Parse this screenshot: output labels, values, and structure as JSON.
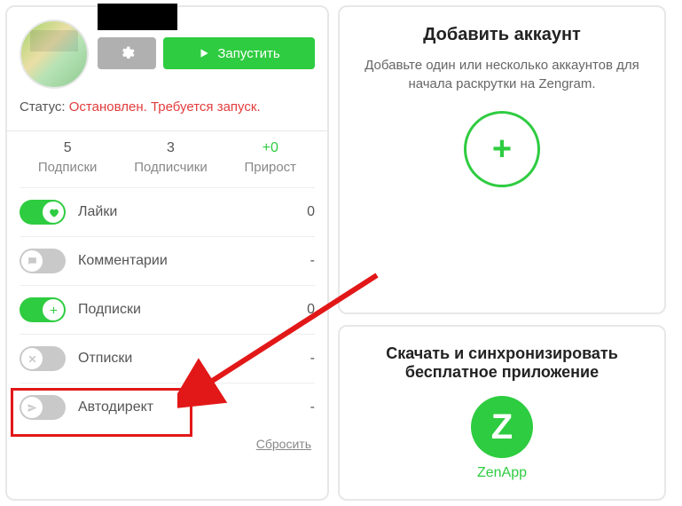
{
  "colors": {
    "accent": "#2ecc40",
    "danger": "#e23c3c",
    "highlight": "#e21818",
    "muted": "#b0b0b0"
  },
  "account": {
    "run_button": "Запустить",
    "status_label": "Статус:",
    "status_value": "Остановлен. Требуется запуск."
  },
  "stats": [
    {
      "value": "5",
      "label": "Подписки",
      "green": false
    },
    {
      "value": "3",
      "label": "Подписчики",
      "green": false
    },
    {
      "value": "+0",
      "label": "Прирост",
      "green": true
    }
  ],
  "options": [
    {
      "id": "likes",
      "label": "Лайки",
      "on": true,
      "value": "0",
      "icon": "heart"
    },
    {
      "id": "comments",
      "label": "Комментарии",
      "on": false,
      "value": "-",
      "icon": "comment"
    },
    {
      "id": "subs",
      "label": "Подписки",
      "on": true,
      "value": "0",
      "icon": "plus"
    },
    {
      "id": "unsubs",
      "label": "Отписки",
      "on": false,
      "value": "-",
      "icon": "x"
    },
    {
      "id": "autodirect",
      "label": "Автодирект",
      "on": false,
      "value": "-",
      "icon": "send"
    }
  ],
  "reset_label": "Сбросить",
  "add_panel": {
    "title": "Добавить аккаунт",
    "subtitle": "Добавьте один или несколько аккаунтов для начала раскрутки на Zengram."
  },
  "app_panel": {
    "title": "Скачать и синхронизировать бесплатное приложение",
    "badge": "Z",
    "name": "ZenApp"
  }
}
